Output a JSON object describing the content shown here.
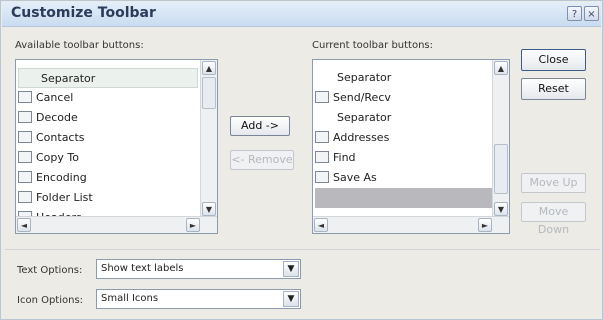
{
  "window": {
    "title": "Customize Toolbar"
  },
  "title_buttons": {
    "help": "?",
    "close": "×"
  },
  "available": {
    "label": "Available toolbar buttons:",
    "items": [
      "Separator",
      "Cancel",
      "Decode",
      "Contacts",
      "Copy To",
      "Encoding",
      "Folder List",
      "Headers"
    ],
    "icons": [
      "none",
      "cancel-icon",
      "decode-icon",
      "contacts-icon",
      "copy-to-icon",
      "encoding-icon",
      "folder-list-icon",
      "headers-icon"
    ]
  },
  "current": {
    "label": "Current toolbar buttons:",
    "items": [
      "Separator",
      "Send/Recv",
      "Separator",
      "Addresses",
      "Find",
      "Save As",
      ""
    ],
    "icons": [
      "none",
      "send-recv-icon",
      "none",
      "addresses-icon",
      "find-icon",
      "save-as-icon",
      "none"
    ]
  },
  "buttons": {
    "add": "Add ->",
    "remove": "<- Remove",
    "close": "Close",
    "reset": "Reset",
    "move_up": "Move Up",
    "move_down": "Move Down"
  },
  "text_options": {
    "label": "Text Options:",
    "value": "Show text labels"
  },
  "icon_options": {
    "label": "Icon Options:",
    "value": "Small Icons"
  },
  "scroll_arrows": {
    "up": "▲",
    "down": "▼",
    "left": "◄",
    "right": "►"
  },
  "colors": {
    "title_text": "#2d3b5a",
    "dialog_bg": "#ecebe6",
    "selection": "#ebf2ee",
    "placeholder_row": "#b9b9bd"
  }
}
